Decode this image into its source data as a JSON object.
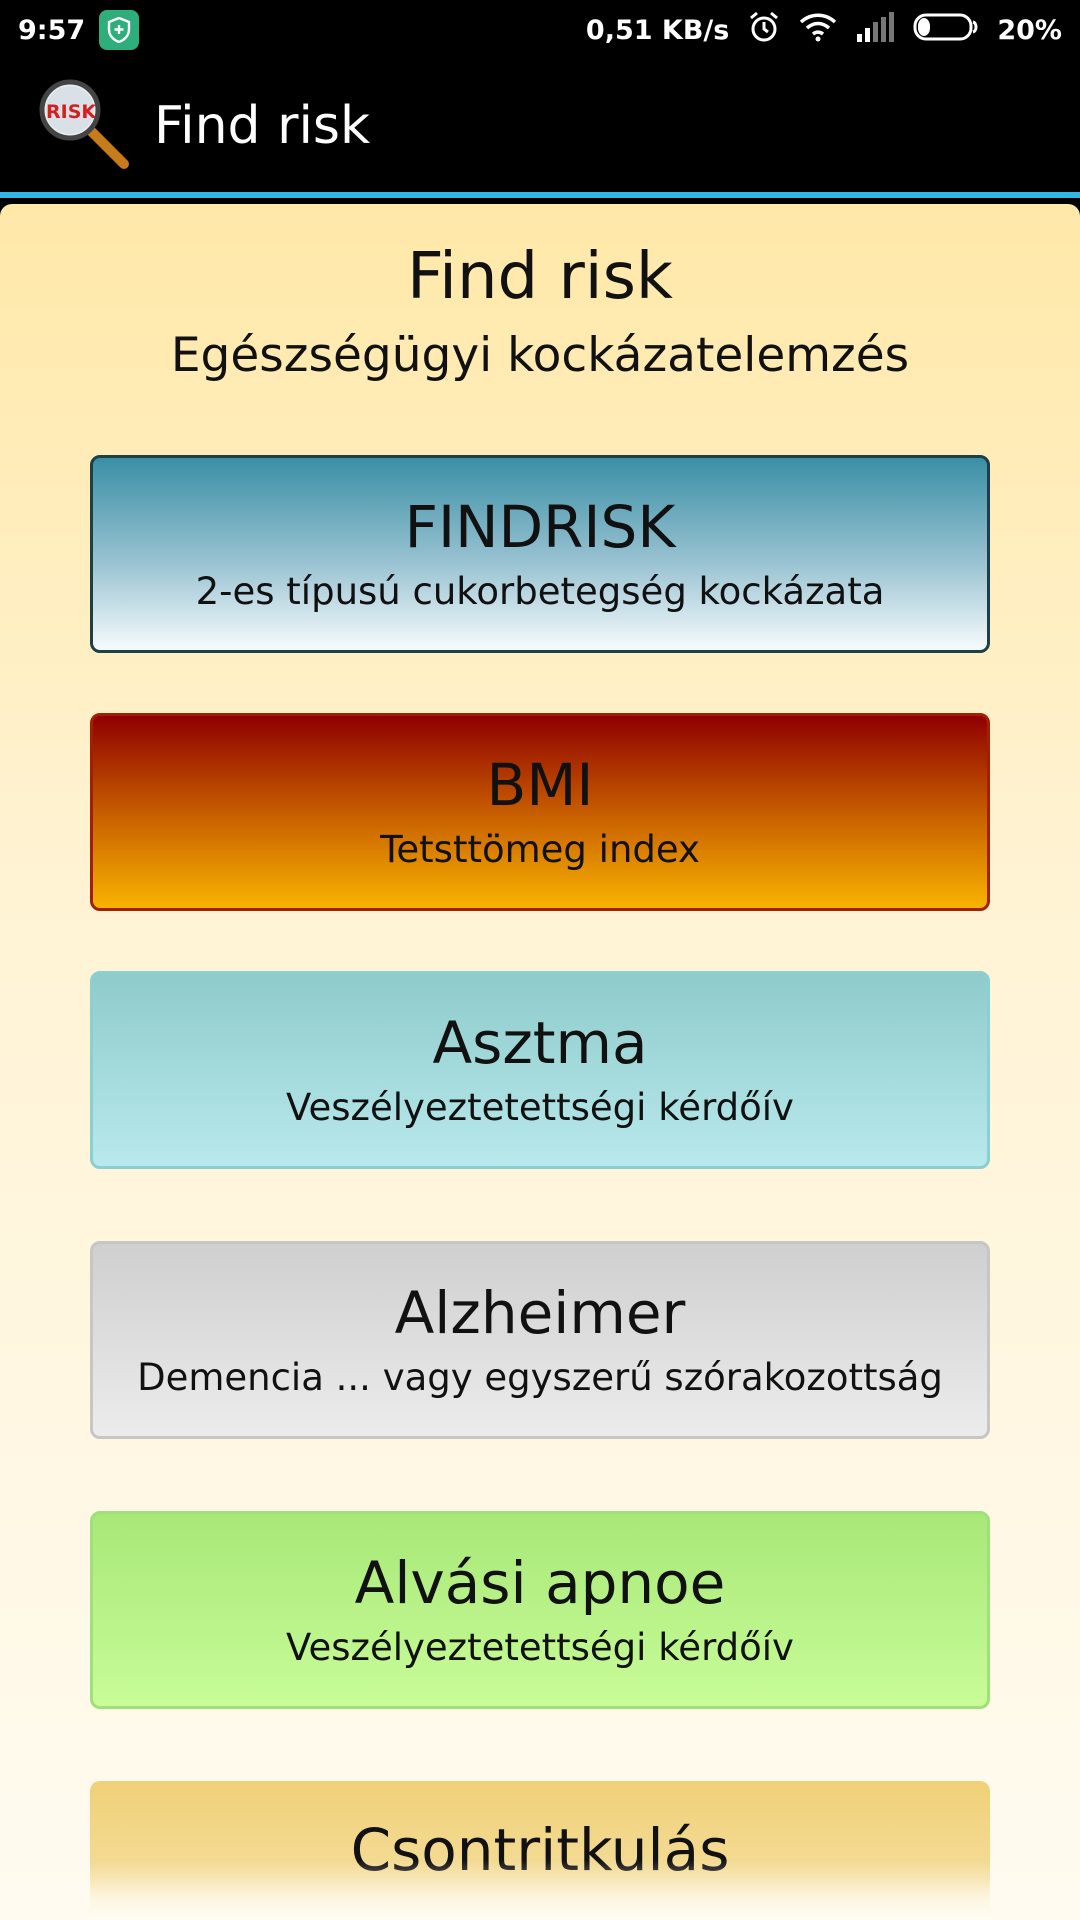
{
  "status_bar": {
    "time": "9:57",
    "network_speed": "0,51 KB/s",
    "battery": "20%"
  },
  "app_bar": {
    "title": "Find risk",
    "logo_text": "RISK"
  },
  "header": {
    "title": "Find risk",
    "subtitle": "Egészségügyi kockázatelemzés"
  },
  "cards": [
    {
      "title": "FINDRISK",
      "subtitle": "2-es típusú cukorbetegség kockázata"
    },
    {
      "title": "BMI",
      "subtitle": "Tetsttömeg index"
    },
    {
      "title": "Asztma",
      "subtitle": "Veszélyeztetettségi kérdőív"
    },
    {
      "title": "Alzheimer",
      "subtitle": "Demencia ... vagy egyszerű szórakozottság"
    },
    {
      "title": "Alvási apnoe",
      "subtitle": "Veszélyeztetettségi kérdőív"
    },
    {
      "title": "Csontritkulás"
    }
  ],
  "colors": {
    "accent": "#33b5e5",
    "background_top": "#ffe8a8",
    "findrisk": "#3a8fa5",
    "bmi": "#c65c00",
    "asthma": "#b8e9ec",
    "alzheimer": "#dcdcdc",
    "apnoe": "#b8f088",
    "bone": "#f0d178"
  }
}
